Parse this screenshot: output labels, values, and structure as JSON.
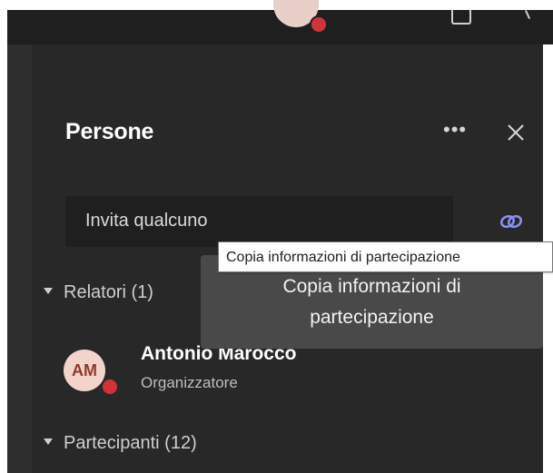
{
  "topbar": {
    "avatar_initials": "",
    "icons": [
      "share-screen-icon",
      "leave-call-icon"
    ]
  },
  "panel": {
    "title": "Persone",
    "more_label": "•••",
    "close_label": "✕",
    "invite": {
      "placeholder": "Invita qualcuno"
    },
    "link_icon": "link-icon"
  },
  "tooltip": {
    "native": "Copia informazioni di partecipazione",
    "styled_line1": "Copia informazioni di",
    "styled_line2": "partecipazione"
  },
  "sections": {
    "presenters": {
      "label": "Relatori (1)",
      "members": [
        {
          "initials": "AM",
          "name": "Antonio Marocco",
          "role": "Organizzatore",
          "status_color": "#d13438"
        }
      ]
    },
    "participants": {
      "label": "Partecipanti (12)"
    }
  },
  "colors": {
    "panel_bg": "#292828",
    "accent": "#7f85f5",
    "busy": "#d13438"
  }
}
